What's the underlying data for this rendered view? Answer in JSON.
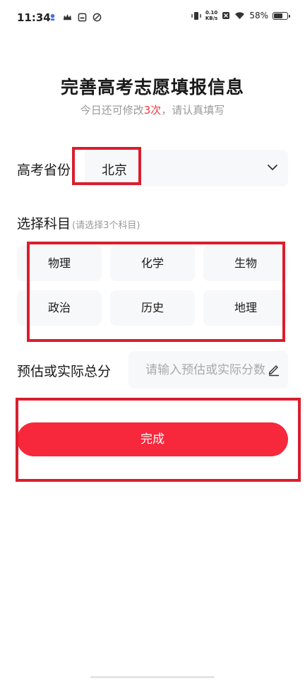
{
  "status_bar": {
    "time": "11:34",
    "net_speed_value": "0.10",
    "net_speed_unit": "KB/s",
    "battery_percent": "58%",
    "battery_level": 0.58
  },
  "header": {
    "title": "完善高考志愿填报信息",
    "subtitle_prefix": "今日还可修改",
    "subtitle_count": "3次",
    "subtitle_suffix": "，请认真填写"
  },
  "province": {
    "label": "高考省份",
    "value": "北京"
  },
  "subjects": {
    "label": "选择科目",
    "hint": "(请选择3个科目)",
    "items": [
      "物理",
      "化学",
      "生物",
      "政治",
      "历史",
      "地理"
    ]
  },
  "score": {
    "label": "预估或实际总分",
    "placeholder": "请输入预估或实际分数"
  },
  "actions": {
    "done_label": "完成"
  },
  "colors": {
    "accent": "#f7273c",
    "highlight": "#f5333f",
    "annotation": "#d91e2e"
  }
}
